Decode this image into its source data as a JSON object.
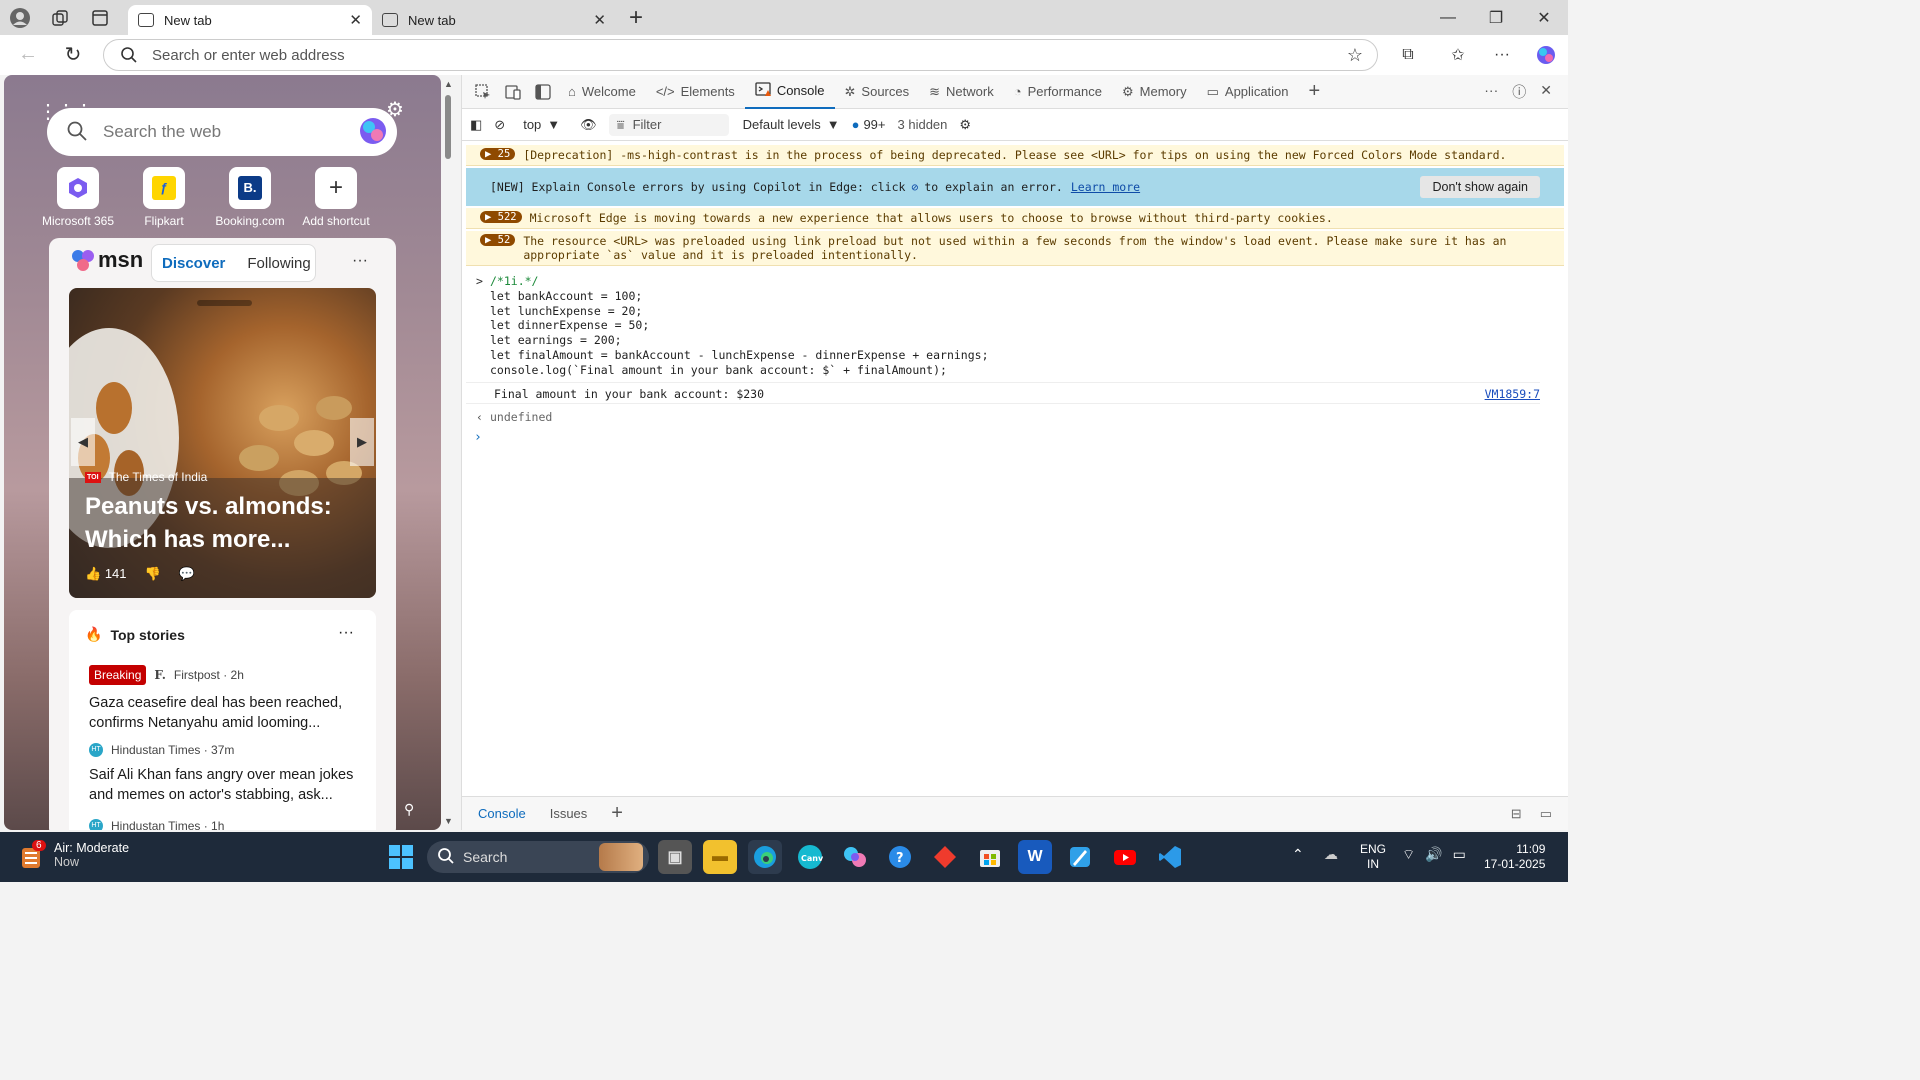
{
  "browser": {
    "tabs": [
      {
        "title": "New tab"
      },
      {
        "title": "New tab"
      }
    ],
    "address_placeholder": "Search or enter web address"
  },
  "ntp": {
    "search_placeholder": "Search the web",
    "shortcuts": [
      "Microsoft 365",
      "Flipkart",
      "Booking.com",
      "Add shortcut"
    ],
    "msn": {
      "logo": "msn",
      "tabs": [
        "Discover",
        "Following"
      ],
      "hero": {
        "source": "The Times of India",
        "headline": "Peanuts vs. almonds: Which has more...",
        "likes": "141"
      },
      "top_stories": {
        "title": "Top stories",
        "items": [
          {
            "badge": "Breaking",
            "source": "Firstpost · 2h",
            "headline": "Gaza ceasefire deal has been reached, confirms Netanyahu amid looming..."
          },
          {
            "source": "Hindustan Times · 37m",
            "headline": "Saif Ali Khan fans angry over mean jokes and memes on actor's stabbing, ask..."
          },
          {
            "source": "Hindustan Times · 1h"
          }
        ]
      }
    }
  },
  "devtools": {
    "tabs": [
      "Welcome",
      "Elements",
      "Console",
      "Sources",
      "Network",
      "Performance",
      "Memory",
      "Application"
    ],
    "toolbar": {
      "context": "top",
      "filter_placeholder": "Filter",
      "levels": "Default levels",
      "msg_count": "99+",
      "hidden": "3 hidden"
    },
    "messages": [
      {
        "count": "25",
        "text": "[Deprecation] -ms-high-contrast is in the process of being deprecated. Please see <URL> for tips on using the new Forced Colors Mode standard."
      },
      {
        "count": "522",
        "text": "Microsoft Edge is moving towards a new experience that allows users to choose to browse without third-party cookies."
      },
      {
        "count": "52",
        "text": "The resource <URL> was preloaded using link preload but not used within a few seconds from the window's load event. Please make sure it has an appropriate `as` value and it is preloaded intentionally."
      }
    ],
    "info": {
      "text_a": "[NEW] Explain Console errors by using Copilot in Edge: click",
      "text_b": "to explain an error.",
      "link": "Learn more",
      "button": "Don't show again"
    },
    "code_lines": [
      "/*1i.*/",
      "let bankAccount = 100;",
      "let lunchExpense = 20;",
      "let dinnerExpense = 50;",
      "let earnings = 200;",
      "let finalAmount = bankAccount - lunchExpense - dinnerExpense + earnings;",
      "console.log(`Final amount in your bank account: $` + finalAmount);"
    ],
    "output": "Final amount in your bank account: $230",
    "source_link": "VM1859:7",
    "return": "undefined",
    "drawer": [
      "Console",
      "Issues"
    ]
  },
  "taskbar": {
    "weather_title": "Air: Moderate",
    "weather_sub": "Now",
    "weather_badge": "6",
    "search": "Search",
    "lang1": "ENG",
    "lang2": "IN",
    "time": "11:09",
    "date": "17-01-2025"
  }
}
